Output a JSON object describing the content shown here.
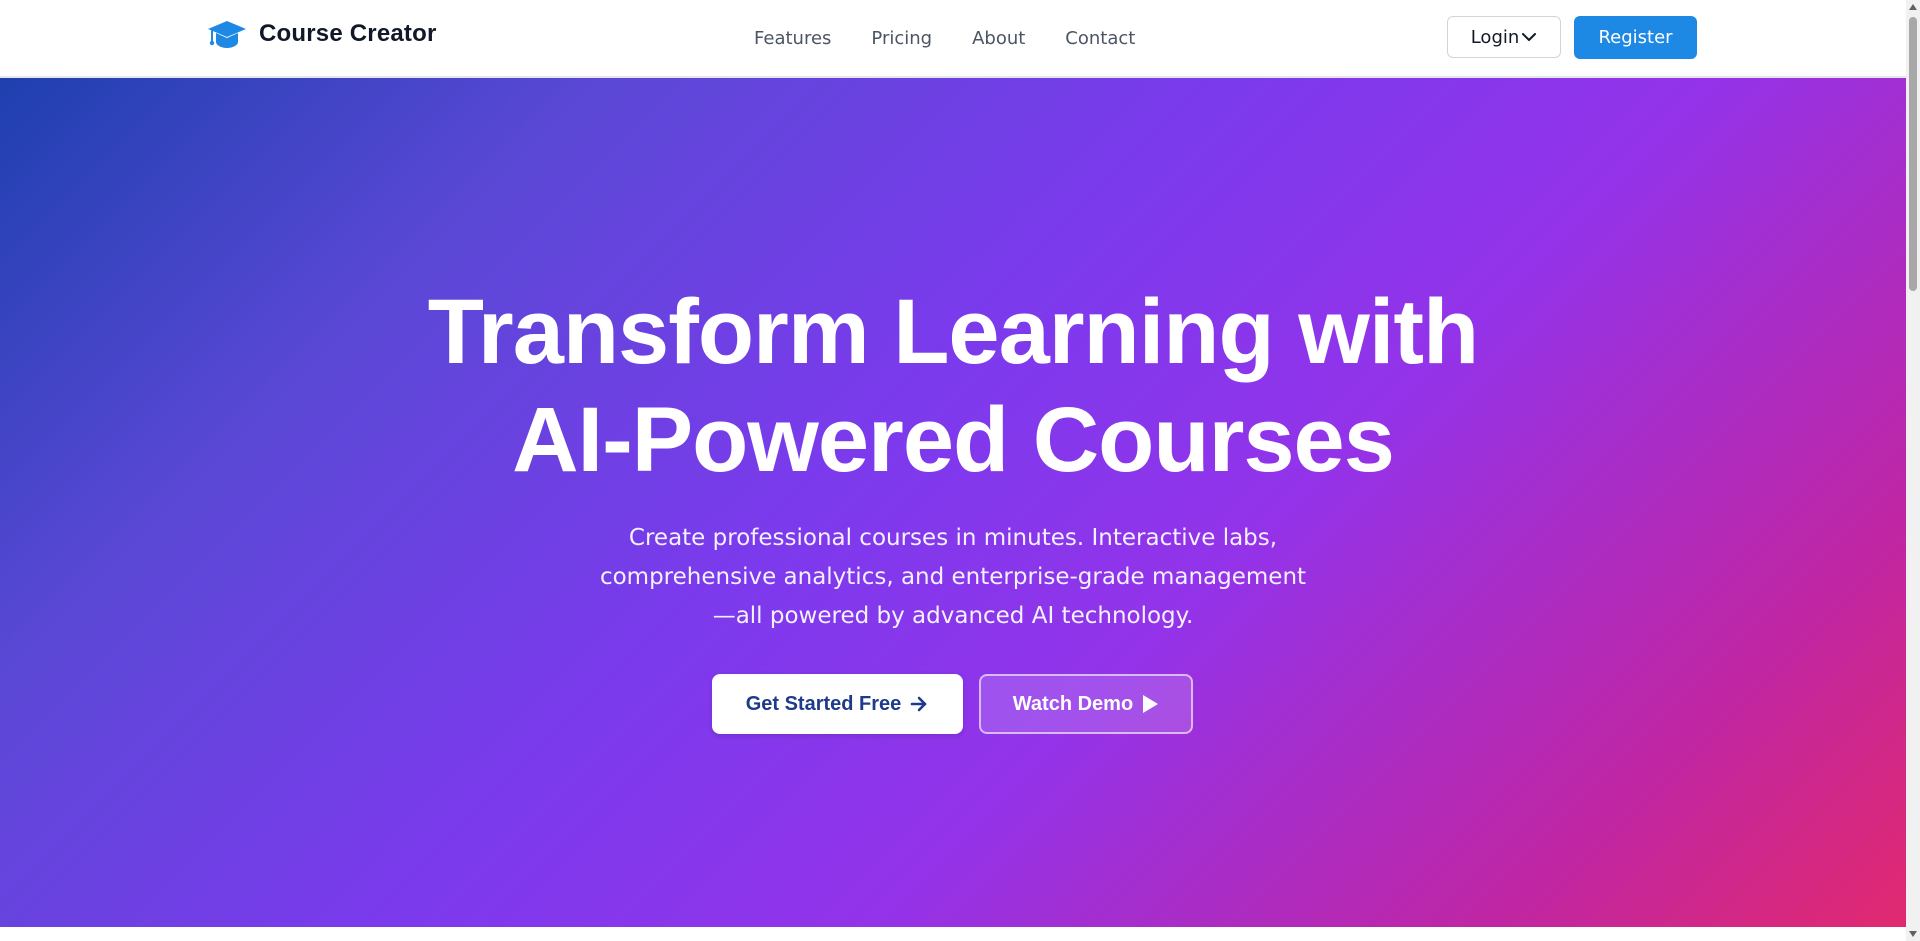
{
  "navbar": {
    "brand_name": "Course Creator",
    "brand_icon": "graduation-cap-icon",
    "links": [
      "Features",
      "Pricing",
      "About",
      "Contact"
    ],
    "login_label": "Login",
    "register_label": "Register"
  },
  "hero": {
    "title_line1": "Transform Learning with",
    "title_line2": "AI-Powered Courses",
    "subtitle_line1": "Create professional courses in minutes. Interactive labs,",
    "subtitle_line2": "comprehensive analytics, and enterprise-grade management",
    "subtitle_line3": "—all powered by advanced AI technology.",
    "primary_cta": "Get Started Free",
    "secondary_cta": "Watch Demo"
  },
  "colors": {
    "brand_accent": "#1e88e5",
    "hero_gradient_start": "#1e40af",
    "hero_gradient_mid": "#7c3aed",
    "hero_gradient_end": "#e1296f"
  }
}
